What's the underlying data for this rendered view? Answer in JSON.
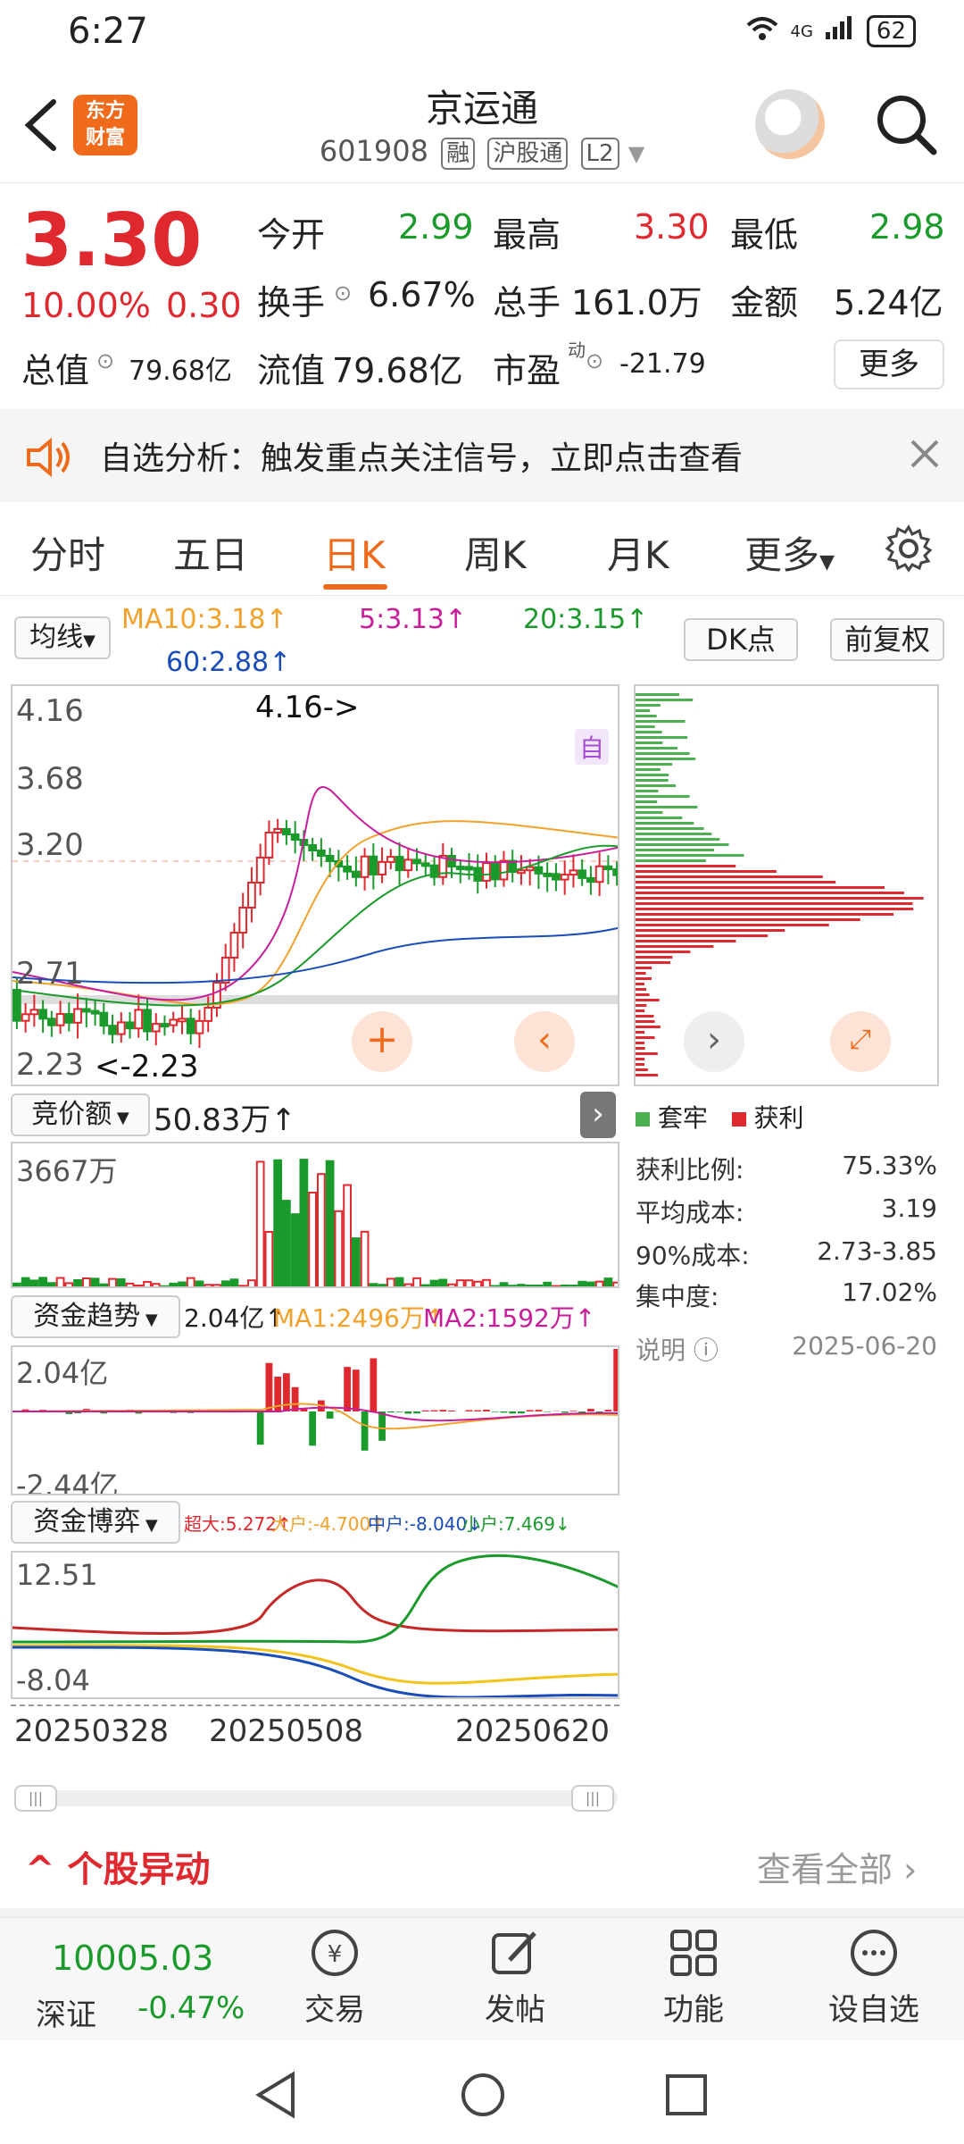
{
  "status": {
    "time": "6:27",
    "network": "4G",
    "battery": "62"
  },
  "header": {
    "brand": "东方\n财富",
    "name": "京运通",
    "code": "601908",
    "tags": [
      "融",
      "沪股通",
      "L2"
    ]
  },
  "quote": {
    "price": "3.30",
    "change_pct": "10.00%",
    "change": "0.30",
    "open_label": "今开",
    "open": "2.99",
    "high_label": "最高",
    "high": "3.30",
    "low_label": "最低",
    "low": "2.98",
    "turnover_label": "换手",
    "turnover": "6.67%",
    "volume_label": "总手",
    "volume": "161.0万",
    "amount_label": "金额",
    "amount": "5.24亿",
    "mktcap_label": "总值",
    "mktcap": "79.68亿",
    "float_label": "流值",
    "float": "79.68亿",
    "pe_label": "市盈",
    "pe_sup": "动",
    "pe": "-21.79",
    "more": "更多"
  },
  "banner": {
    "text": "自选分析：触发重点关注信号，立即点击查看"
  },
  "tabs": [
    "分时",
    "五日",
    "日K",
    "周K",
    "月K",
    "更多"
  ],
  "ma": {
    "selector": "均线",
    "ma10": "MA10:3.18↑",
    "ma5": "5:3.13↑",
    "ma20": "20:3.15↑",
    "ma60": "60:2.88↑",
    "dk": "DK点",
    "adjust": "前复权"
  },
  "kline": {
    "y_labels": [
      "4.16",
      "3.68",
      "3.20",
      "2.71",
      "2.23"
    ],
    "high_note": "4.16->",
    "low_note": "<-2.23",
    "self_tag": "自"
  },
  "chart_data": [
    {
      "type": "bar",
      "title": "竞价额",
      "value_label": "50.83万↑",
      "y_max_label": "3667万"
    },
    {
      "type": "bar",
      "title": "资金趋势",
      "value_label": "2.04亿↑",
      "ma1": "MA1:2496万↑",
      "ma2": "MA2:1592万↑",
      "y_labels": [
        "2.04亿",
        "-2.44亿"
      ]
    },
    {
      "type": "line",
      "title": "资金博弈",
      "legend": [
        "超大:5.272↑",
        "大户:-4.700↑",
        "中户:-8.040↓",
        "小户:7.469↓"
      ],
      "y_labels": [
        "12.51",
        "-8.04"
      ],
      "x_labels": [
        "20250328",
        "20250508",
        "20250620"
      ]
    }
  ],
  "chip": {
    "legend_trapped": "套牢",
    "legend_profit": "获利",
    "rows": [
      {
        "label": "获利比例:",
        "value": "75.33%"
      },
      {
        "label": "平均成本:",
        "value": "3.19"
      },
      {
        "label": "90%成本:",
        "value": "2.73-3.85"
      },
      {
        "label": "集中度:",
        "value": "17.02%"
      }
    ],
    "note": "说明",
    "date": "2025-06-20"
  },
  "news": {
    "title": "个股异动",
    "view_all": "查看全部"
  },
  "bottom": {
    "index_value": "10005.03",
    "index_name": "深证",
    "index_change": "-0.47%",
    "trade": "交易",
    "post": "发帖",
    "function": "功能",
    "add": "设自选"
  },
  "colors": {
    "up": "#e0282f",
    "down": "#1a9a2b",
    "accent": "#f06a1c"
  }
}
